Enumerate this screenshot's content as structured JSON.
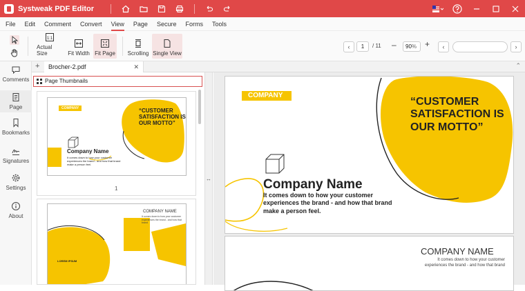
{
  "app": {
    "title": "Systweak PDF Editor"
  },
  "menu": [
    "File",
    "Edit",
    "Comment",
    "Convert",
    "View",
    "Page",
    "Secure",
    "Forms",
    "Tools"
  ],
  "toolbar": {
    "actual_size": "Actual Size",
    "fit_width": "Fit Width",
    "fit_page": "Fit Page",
    "scrolling": "Scrolling",
    "single_view": "Single View",
    "page_current": "1",
    "page_total": "/ 11",
    "zoom_value": "90",
    "zoom_unit": "%"
  },
  "sidebar": {
    "comments": "Comments",
    "page": "Page",
    "bookmarks": "Bookmarks",
    "signatures": "Signatures",
    "settings": "Settings",
    "about": "About"
  },
  "document": {
    "tab": "Brocher-2.pdf",
    "thumbs_header": "Page Thumbnails"
  },
  "page1": {
    "tag": "COMPANY",
    "quote_line1": "“CUSTOMER",
    "quote_line2": "SATISFACTION IS",
    "quote_line3": "OUR MOTTO”",
    "company_name": "Company Name",
    "desc_line1": "It comes down to how your customer",
    "desc_line2": "experiences the brand - and how that brand",
    "desc_line3": "make a person feel."
  },
  "page2": {
    "company_name": "COMPANY NAME",
    "lorem": "LOREM IPSUM",
    "desc_line1": "It comes down to how your customer",
    "desc_line2": "experiences the brand - and how that brand"
  },
  "thumb_labels": [
    "1"
  ],
  "colors": {
    "accent": "#e04848",
    "brand_yellow": "#f6c400"
  }
}
